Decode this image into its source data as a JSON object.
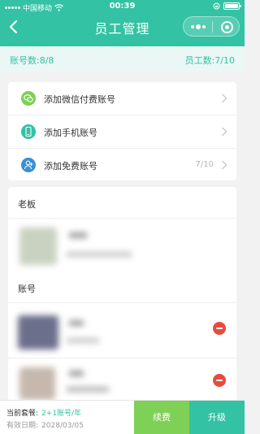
{
  "status_bar": {
    "carrier": "中国移动",
    "time": "00:39"
  },
  "nav": {
    "title": "员工管理"
  },
  "stats": {
    "accounts": "账号数:8/8",
    "employees": "员工数:7/10"
  },
  "add_options": [
    {
      "label": "添加微信付费账号",
      "icon": "wechat-icon",
      "count": ""
    },
    {
      "label": "添加手机账号",
      "icon": "phone-icon",
      "count": ""
    },
    {
      "label": "添加免费账号",
      "icon": "user-icon",
      "count": "7/10"
    }
  ],
  "sections": {
    "boss": "老板",
    "accounts": "账号"
  },
  "footer": {
    "plan_label": "当前套餐:",
    "plan_value": "2+1账号/年",
    "expire_label": "有效日期:",
    "expire_value": "2028/03/05",
    "renew_button": "续费",
    "upgrade_button": "升级"
  },
  "colors": {
    "primary": "#33c2a4",
    "renew": "#7ed056",
    "danger": "#e64c3c"
  }
}
